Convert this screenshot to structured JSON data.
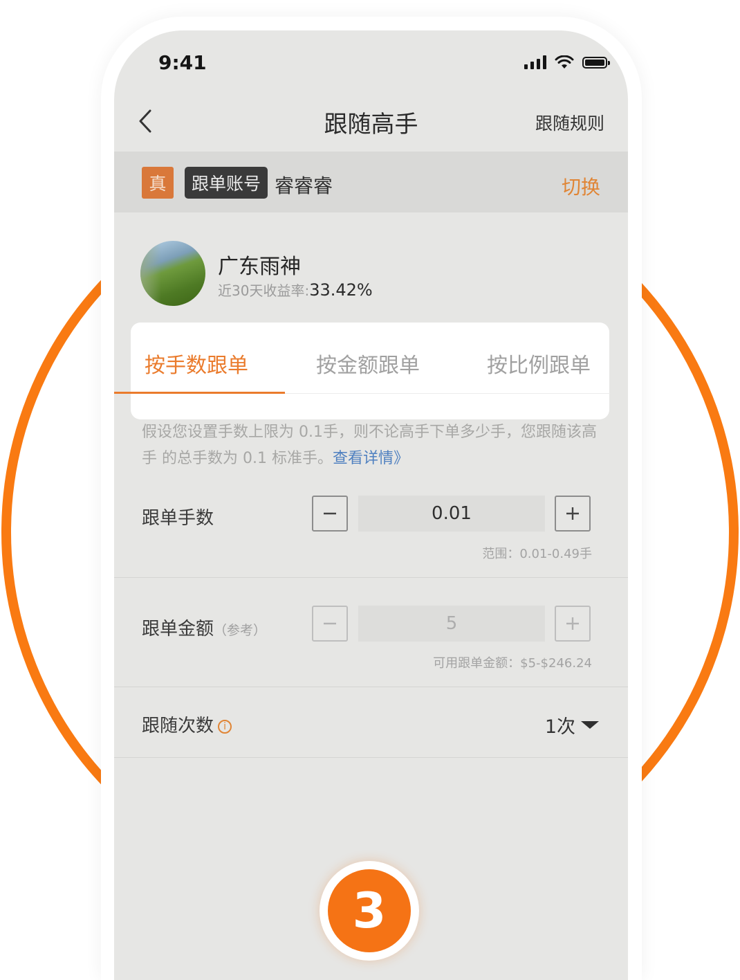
{
  "status_bar": {
    "time": "9:41"
  },
  "nav": {
    "title": "跟随高手",
    "right_label": "跟随规则"
  },
  "account": {
    "real_badge": "真",
    "tag": "跟单账号",
    "name": "睿睿睿",
    "switch_label": "切换"
  },
  "trader": {
    "name": "广东雨神",
    "stat_label": "近30天收益率:",
    "stat_value": "33.42%"
  },
  "tabs": [
    {
      "label": "按手数跟单",
      "active": true
    },
    {
      "label": "按金额跟单",
      "active": false
    },
    {
      "label": "按比例跟单",
      "active": false
    }
  ],
  "description": {
    "text": "假设您设置手数上限为 0.1手，则不论高手下单多少手，您跟随该高手 的总手数为 0.1 标准手。",
    "link": "查看详情》"
  },
  "lots": {
    "label": "跟单手数",
    "value": "0.01",
    "hint": "范围：0.01-0.49手"
  },
  "amount": {
    "label": "跟单金额",
    "sub_label": "（参考）",
    "value": "5",
    "hint": "可用跟单金额：$5-$246.24"
  },
  "times": {
    "label": "跟随次数",
    "info_glyph": "i",
    "value": "1次"
  },
  "step_number": "3",
  "colors": {
    "accent": "#ea7b2c",
    "ring": "#f97a12",
    "badge": "#f57315",
    "link": "#4f80c0",
    "dim_screen": "#e6e6e4"
  }
}
